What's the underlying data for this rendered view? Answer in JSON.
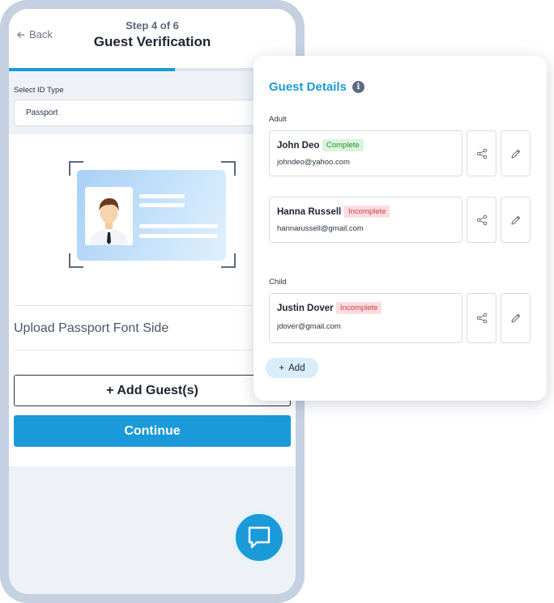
{
  "header": {
    "back_label": "Back",
    "step": "Step 4 of 6",
    "title": "Guest Verification",
    "progress_percent": 58
  },
  "id_type": {
    "label": "Select ID Type",
    "value": "Passport"
  },
  "upload": {
    "label": "Upload Passport Font Side"
  },
  "actions": {
    "add_guest_label": "+ Add Guest(s)",
    "continue_label": "Continue"
  },
  "guest_details": {
    "title": "Guest Details",
    "info_icon": "info-icon",
    "groups": [
      {
        "label": "Adult",
        "guests": [
          {
            "name": "John Deo",
            "status": "Complete",
            "email": "johndeo@yahoo.com"
          },
          {
            "name": "Hanna Russell",
            "status": "Incomplete",
            "email": "hannarussell@gmail.com"
          }
        ]
      },
      {
        "label": "Child",
        "guests": [
          {
            "name": "Justin Dover",
            "status": "Incomplete",
            "email": "jdover@gmail.com"
          }
        ]
      }
    ],
    "add_label": "Add",
    "add_icon": "plus"
  },
  "colors": {
    "accent": "#1a9ad9",
    "complete_bg": "#d9f3dc",
    "complete_text": "#2e8b3a",
    "incomplete_bg": "#fbdde0",
    "incomplete_text": "#d13a48"
  }
}
